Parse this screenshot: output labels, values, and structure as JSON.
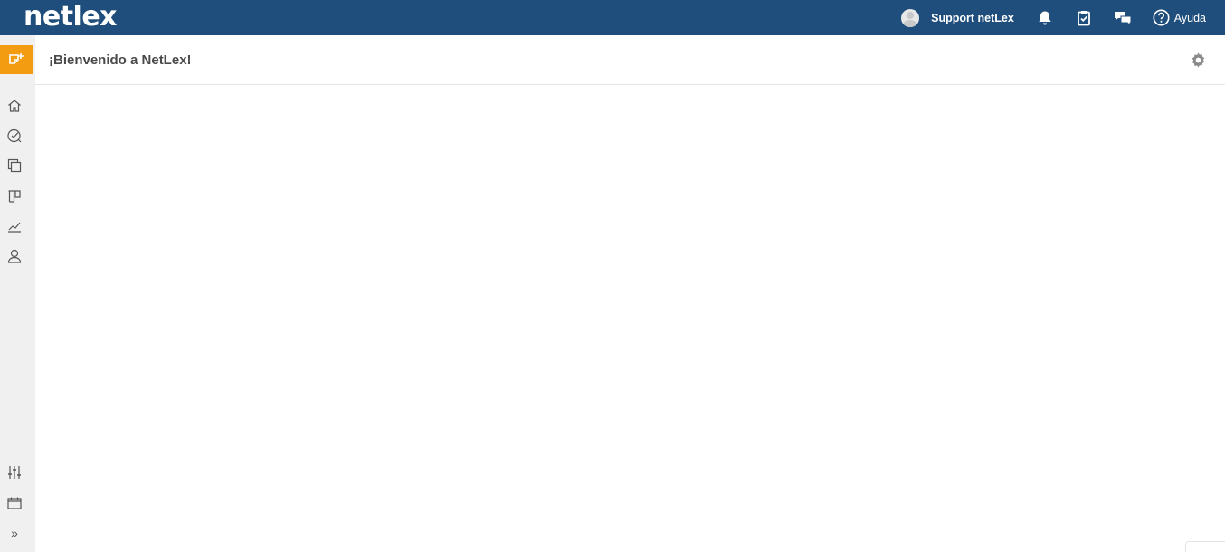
{
  "app": {
    "logo_text": "netlex",
    "brand_color": "#1f4e7c",
    "accent_color": "#f39c12"
  },
  "topbar": {
    "user_name": "Support netLex",
    "icons": [
      "avatar",
      "bell-icon",
      "clipboard-check-icon",
      "chat-bubbles-icon",
      "help-circle-icon"
    ],
    "help_label": "Ayuda"
  },
  "sidebar": {
    "new_button_icon": "add-note-icon",
    "items": [
      {
        "icon": "home-icon"
      },
      {
        "icon": "tasks-check-icon"
      },
      {
        "icon": "documents-icon"
      },
      {
        "icon": "board-icon"
      },
      {
        "icon": "chart-icon"
      },
      {
        "icon": "user-icon"
      }
    ],
    "bottom_items": [
      {
        "icon": "sliders-icon"
      },
      {
        "icon": "calendar-icon"
      },
      {
        "icon": "expand-chevrons-icon"
      }
    ],
    "expand_glyph": "»"
  },
  "main": {
    "title": "¡Bienvenido a NetLex!",
    "settings_icon": "gear-icon"
  }
}
